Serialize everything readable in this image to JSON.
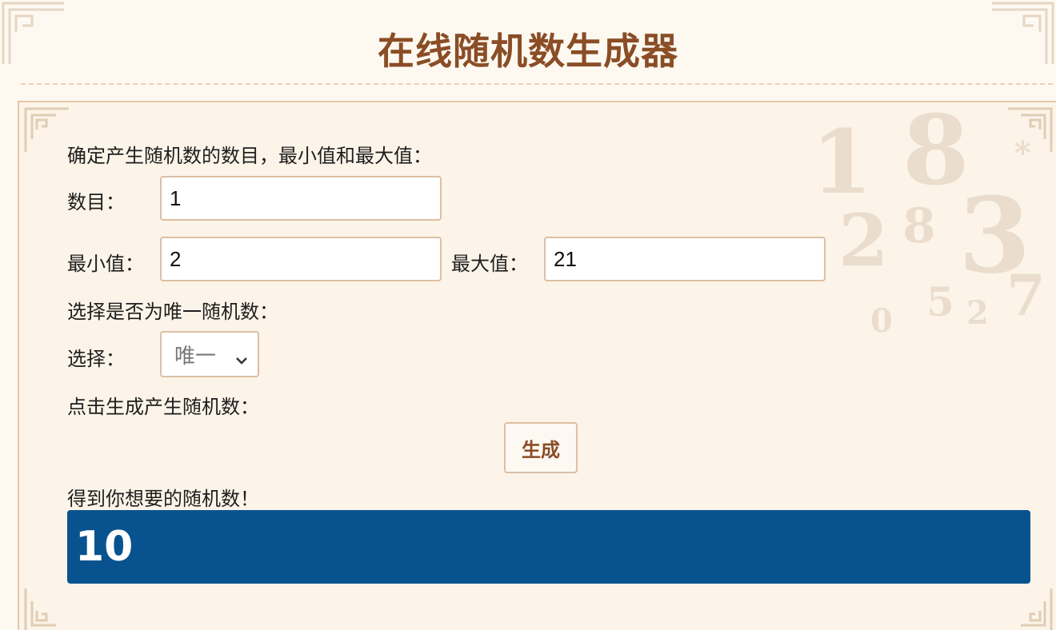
{
  "header": {
    "title": "在线随机数生成器"
  },
  "form": {
    "intro": "确定产生随机数的数目，最小值和最大值：",
    "count": {
      "label": "数目：",
      "value": "1"
    },
    "min": {
      "label": "最小值：",
      "value": "2"
    },
    "max": {
      "label": "最大值：",
      "value": "21"
    },
    "unique_prompt": "选择是否为唯一随机数：",
    "choice": {
      "label": "选择：",
      "selected": "唯一"
    },
    "generate_prompt": "点击生成产生随机数：",
    "generate_label": "生成",
    "result_prompt": "得到你想要的随机数！",
    "result_value": "10"
  },
  "colors": {
    "title": "#8a4d25",
    "result_bg": "#08538f",
    "border": "#dcbfa4"
  },
  "icons": [
    "chevron-down-icon",
    "corner-ornament-icon"
  ]
}
